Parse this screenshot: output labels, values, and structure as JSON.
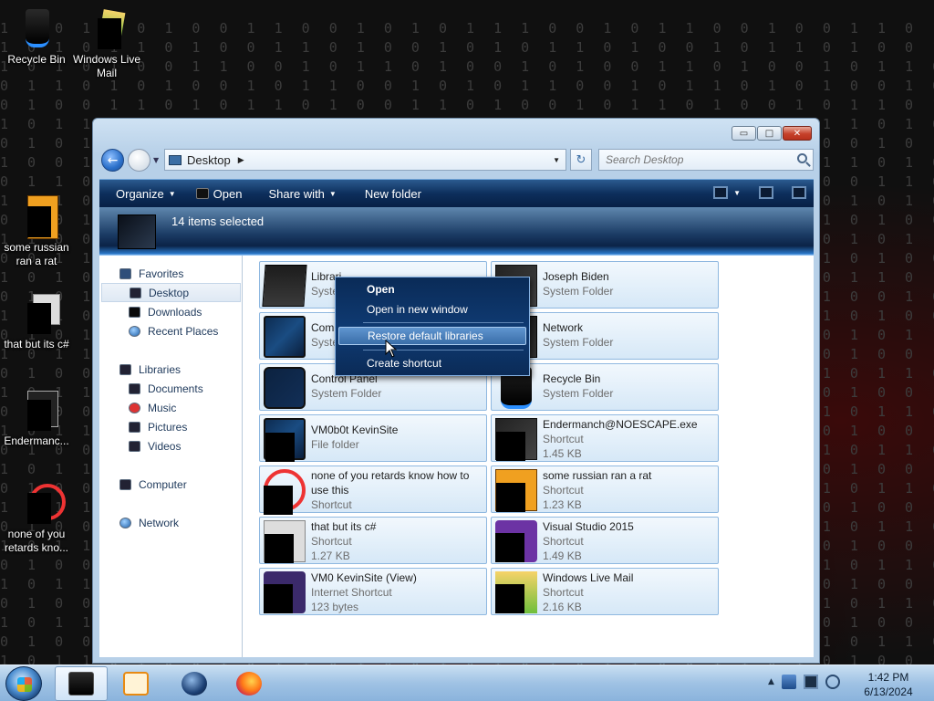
{
  "desktop": {
    "icons": [
      {
        "label": "Recycle Bin"
      },
      {
        "label": "Windows Live Mail"
      },
      {
        "label": "some russian ran a rat"
      },
      {
        "label": "that but its c#"
      },
      {
        "label": "Endermanc..."
      },
      {
        "label": "none of you retards kno..."
      }
    ]
  },
  "window": {
    "address_location": "Desktop",
    "search_placeholder": "Search Desktop",
    "caption": {
      "minimize": "▭",
      "maximize": "□",
      "close": "✕"
    },
    "toolbar": {
      "organize": "Organize",
      "open": "Open",
      "share_with": "Share with",
      "new_folder": "New folder"
    },
    "selection_status": "14 items selected"
  },
  "navigation": {
    "favorites": "Favorites",
    "desktop": "Desktop",
    "downloads": "Downloads",
    "recent_places": "Recent Places",
    "libraries": "Libraries",
    "documents": "Documents",
    "music": "Music",
    "pictures": "Pictures",
    "videos": "Videos",
    "computer": "Computer",
    "network": "Network"
  },
  "items": [
    {
      "name": "Librari",
      "sub1": "System",
      "sub2": ""
    },
    {
      "name": "Joseph Biden",
      "sub1": "System Folder",
      "sub2": ""
    },
    {
      "name": "Comp",
      "sub1": "System",
      "sub2": ""
    },
    {
      "name": "Network",
      "sub1": "System Folder",
      "sub2": ""
    },
    {
      "name": "Control Panel",
      "sub1": "System Folder",
      "sub2": ""
    },
    {
      "name": "Recycle Bin",
      "sub1": "System Folder",
      "sub2": ""
    },
    {
      "name": "VM0b0t KevinSite",
      "sub1": "File folder",
      "sub2": ""
    },
    {
      "name": "Endermanch@NOESCAPE.exe",
      "sub1": "Shortcut",
      "sub2": "1.45 KB"
    },
    {
      "name": "none of you retards know how to use this",
      "sub1": "Shortcut",
      "sub2": ""
    },
    {
      "name": "some russian ran a rat",
      "sub1": "Shortcut",
      "sub2": "1.23 KB"
    },
    {
      "name": "that but its c#",
      "sub1": "Shortcut",
      "sub2": "1.27 KB"
    },
    {
      "name": "Visual Studio 2015",
      "sub1": "Shortcut",
      "sub2": "1.49 KB"
    },
    {
      "name": "VM0 KevinSite (View)",
      "sub1": "Internet Shortcut",
      "sub2": "123 bytes"
    },
    {
      "name": "Windows Live Mail",
      "sub1": "Shortcut",
      "sub2": "2.16 KB"
    }
  ],
  "context_menu": {
    "open": "Open",
    "open_new_window": "Open in new window",
    "restore_libraries": "Restore default libraries",
    "create_shortcut": "Create shortcut"
  },
  "taskbar": {
    "time": "1:42 PM",
    "date": "6/13/2024",
    "tray_arrow": "▲"
  }
}
